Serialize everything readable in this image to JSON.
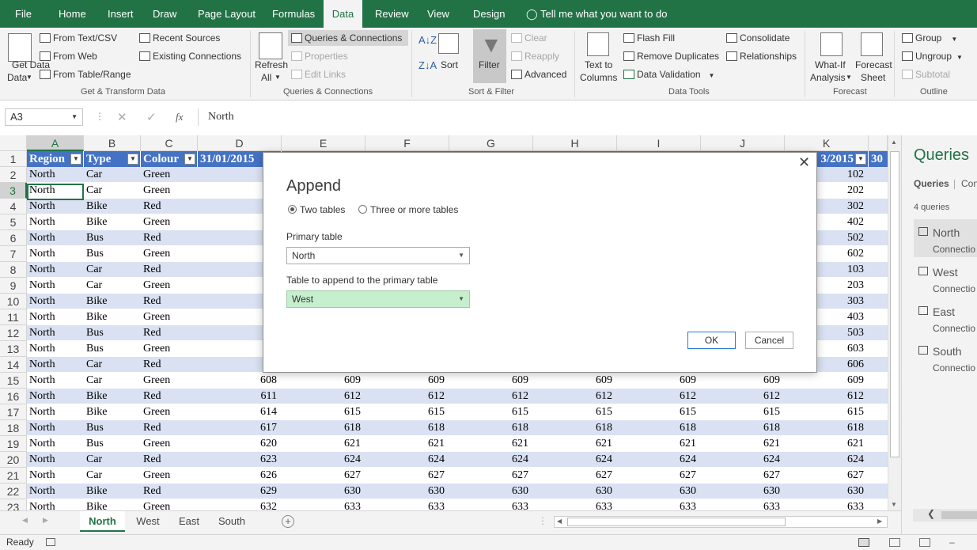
{
  "tabs": [
    "File",
    "Home",
    "Insert",
    "Draw",
    "Page Layout",
    "Formulas",
    "Data",
    "Review",
    "View",
    "Design"
  ],
  "tell_me": "Tell me what you want to do",
  "ribbon": {
    "get_data": "Get Data",
    "get_data2": "Data",
    "from_text": "From Text/CSV",
    "from_web": "From Web",
    "from_table": "From Table/Range",
    "recent_sources": "Recent Sources",
    "existing_connections": "Existing Connections",
    "group_get_transform": "Get & Transform Data",
    "refresh": "Refresh",
    "refresh_all": "All",
    "queries_connections": "Queries & Connections",
    "properties": "Properties",
    "edit_links": "Edit Links",
    "group_queries": "Queries & Connections",
    "sort": "Sort",
    "filter": "Filter",
    "clear": "Clear",
    "reapply": "Reapply",
    "advanced": "Advanced",
    "group_sort_filter": "Sort & Filter",
    "text_to_columns_1": "Text to",
    "text_to_columns_2": "Columns",
    "flash_fill": "Flash Fill",
    "remove_duplicates": "Remove Duplicates",
    "data_validation": "Data Validation",
    "consolidate": "Consolidate",
    "relationships": "Relationships",
    "group_data_tools": "Data Tools",
    "what_if_1": "What-If",
    "what_if_2": "Analysis",
    "forecast_sheet_1": "Forecast",
    "forecast_sheet_2": "Sheet",
    "group_forecast": "Forecast",
    "group": "Group",
    "ungroup": "Ungroup",
    "subtotal": "Subtotal",
    "group_outline": "Outline"
  },
  "formula_bar": {
    "name_box": "A3",
    "fx": "fx",
    "value": "North"
  },
  "columns": [
    "A",
    "B",
    "C",
    "D",
    "E",
    "F",
    "G",
    "H",
    "I",
    "J",
    "K"
  ],
  "header_row": {
    "a": "Region",
    "b": "Type",
    "c": "Colour",
    "d": "31/01/2015",
    "k": "3/2015",
    "l": "30"
  },
  "rows": [
    {
      "n": "2",
      "a": "North",
      "b": "Car",
      "c": "Green",
      "k": "102"
    },
    {
      "n": "3",
      "a": "North",
      "b": "Car",
      "c": "Green",
      "k": "202"
    },
    {
      "n": "4",
      "a": "North",
      "b": "Bike",
      "c": "Red",
      "k": "302"
    },
    {
      "n": "5",
      "a": "North",
      "b": "Bike",
      "c": "Green",
      "k": "402"
    },
    {
      "n": "6",
      "a": "North",
      "b": "Bus",
      "c": "Red",
      "k": "502"
    },
    {
      "n": "7",
      "a": "North",
      "b": "Bus",
      "c": "Green",
      "k": "602"
    },
    {
      "n": "8",
      "a": "North",
      "b": "Car",
      "c": "Red",
      "k": "103"
    },
    {
      "n": "9",
      "a": "North",
      "b": "Car",
      "c": "Green",
      "k": "203"
    },
    {
      "n": "10",
      "a": "North",
      "b": "Bike",
      "c": "Red",
      "k": "303"
    },
    {
      "n": "11",
      "a": "North",
      "b": "Bike",
      "c": "Green",
      "k": "403"
    },
    {
      "n": "12",
      "a": "North",
      "b": "Bus",
      "c": "Red",
      "k": "503"
    },
    {
      "n": "13",
      "a": "North",
      "b": "Bus",
      "c": "Green",
      "k": "603"
    },
    {
      "n": "14",
      "a": "North",
      "b": "Car",
      "c": "Red",
      "k": "606"
    },
    {
      "n": "15",
      "a": "North",
      "b": "Car",
      "c": "Green",
      "d": "608",
      "e": "609",
      "f": "609",
      "g": "609",
      "h": "609",
      "i": "609",
      "j": "609",
      "k": "609"
    },
    {
      "n": "16",
      "a": "North",
      "b": "Bike",
      "c": "Red",
      "d": "611",
      "e": "612",
      "f": "612",
      "g": "612",
      "h": "612",
      "i": "612",
      "j": "612",
      "k": "612"
    },
    {
      "n": "17",
      "a": "North",
      "b": "Bike",
      "c": "Green",
      "d": "614",
      "e": "615",
      "f": "615",
      "g": "615",
      "h": "615",
      "i": "615",
      "j": "615",
      "k": "615"
    },
    {
      "n": "18",
      "a": "North",
      "b": "Bus",
      "c": "Red",
      "d": "617",
      "e": "618",
      "f": "618",
      "g": "618",
      "h": "618",
      "i": "618",
      "j": "618",
      "k": "618"
    },
    {
      "n": "19",
      "a": "North",
      "b": "Bus",
      "c": "Green",
      "d": "620",
      "e": "621",
      "f": "621",
      "g": "621",
      "h": "621",
      "i": "621",
      "j": "621",
      "k": "621"
    },
    {
      "n": "20",
      "a": "North",
      "b": "Car",
      "c": "Red",
      "d": "623",
      "e": "624",
      "f": "624",
      "g": "624",
      "h": "624",
      "i": "624",
      "j": "624",
      "k": "624"
    },
    {
      "n": "21",
      "a": "North",
      "b": "Car",
      "c": "Green",
      "d": "626",
      "e": "627",
      "f": "627",
      "g": "627",
      "h": "627",
      "i": "627",
      "j": "627",
      "k": "627"
    },
    {
      "n": "22",
      "a": "North",
      "b": "Bike",
      "c": "Red",
      "d": "629",
      "e": "630",
      "f": "630",
      "g": "630",
      "h": "630",
      "i": "630",
      "j": "630",
      "k": "630"
    },
    {
      "n": "23",
      "a": "North",
      "b": "Bike",
      "c": "Green",
      "d": "632",
      "e": "633",
      "f": "633",
      "g": "633",
      "h": "633",
      "i": "633",
      "j": "633",
      "k": "633"
    }
  ],
  "sheet_tabs": [
    "North",
    "West",
    "East",
    "South"
  ],
  "status": "Ready",
  "queries_pane": {
    "title": "Queries",
    "tab_queries": "Queries",
    "tab_connections": "Con",
    "count": "4 queries",
    "items": [
      {
        "name": "North",
        "sub": "Connectio"
      },
      {
        "name": "West",
        "sub": "Connectio"
      },
      {
        "name": "East",
        "sub": "Connectio"
      },
      {
        "name": "South",
        "sub": "Connectio"
      }
    ]
  },
  "dialog": {
    "title": "Append",
    "radio_two": "Two tables",
    "radio_three": "Three or more tables",
    "primary_label": "Primary table",
    "primary_value": "North",
    "append_label": "Table to append to the primary table",
    "append_value": "West",
    "ok": "OK",
    "cancel": "Cancel"
  },
  "colors": {
    "excel_green": "#217346",
    "table_header": "#4472c4",
    "band": "#d9e1f2",
    "highlight": "#c6efce"
  }
}
